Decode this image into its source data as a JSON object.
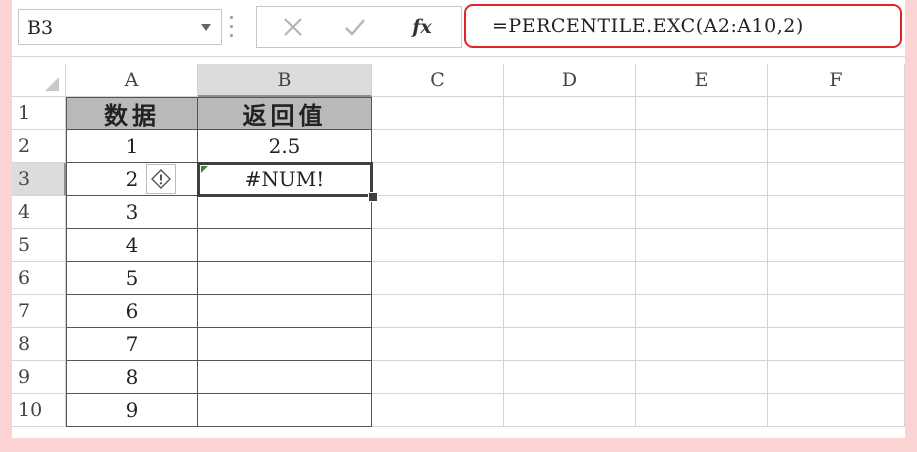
{
  "formula_bar": {
    "name_box": "B3",
    "fx_label": "fx",
    "formula": "=PERCENTILE.EXC(A2:A10,2)"
  },
  "icons": {
    "cancel": "close-icon",
    "enter": "check-icon",
    "error": "error-diamond-icon"
  },
  "columns": [
    "A",
    "B",
    "C",
    "D",
    "E",
    "F"
  ],
  "rows": [
    "1",
    "2",
    "3",
    "4",
    "5",
    "6",
    "7",
    "8",
    "9",
    "10"
  ],
  "table": {
    "headers": [
      "数据",
      "返回值"
    ],
    "col_a": [
      "1",
      "2",
      "3",
      "4",
      "5",
      "6",
      "7",
      "8",
      "9"
    ],
    "col_b": [
      "2.5",
      "#NUM!"
    ]
  },
  "colors": {
    "formula_highlight": "#e0252a",
    "header_fill": "#b9b9b9",
    "background": "#fbd3d3"
  }
}
